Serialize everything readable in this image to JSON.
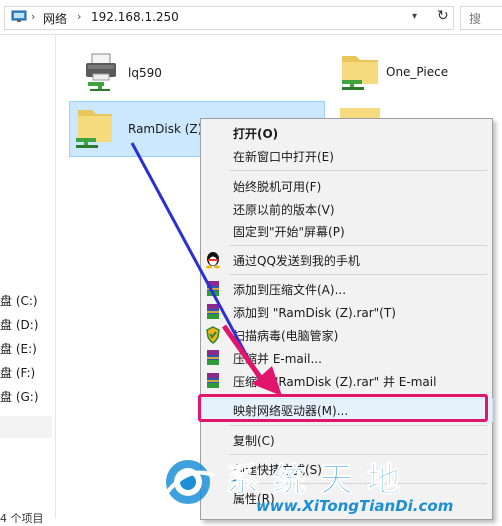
{
  "address": {
    "crumbs": [
      "网络",
      "192.168.1.250"
    ],
    "search_label": "搜"
  },
  "nav": {
    "drives": [
      "盘 (C:)",
      "盘 (D:)",
      "盘 (E:)",
      "盘 (F:)",
      "盘 (G:)"
    ],
    "status": "4 个项目"
  },
  "items": {
    "printer": "lq590",
    "onepiece": "One_Piece",
    "ramdisk": "RamDisk (Z)"
  },
  "menu": {
    "open": "打开(O)",
    "open_new": "在新窗口中打开(E)",
    "offline": "始终脱机可用(F)",
    "restore": "还原以前的版本(V)",
    "pin_start": "固定到\"开始\"屏幕(P)",
    "qq_send": "通过QQ发送到我的手机",
    "add_archive": "添加到压缩文件(A)...",
    "add_rar": "添加到 \"RamDisk (Z).rar\"(T)",
    "scan": "扫描病毒(电脑管家)",
    "compress_email": "压缩并 E-mail...",
    "compress_rar_email": "压缩到 \"RamDisk (Z).rar\" 并 E-mail",
    "map_drive": "映射网络驱动器(M)...",
    "copy": "复制(C)",
    "shortcut": "创建快捷方式(S)",
    "properties": "属性(R)"
  },
  "watermark": {
    "title": "系统天地",
    "url": "www.XiTongTianDi.com"
  },
  "colors": {
    "selection": "#cce8ff",
    "highlight_box": "#e0156b",
    "arrow": "#2a2fd6",
    "watermark": "#1c8fd6"
  }
}
